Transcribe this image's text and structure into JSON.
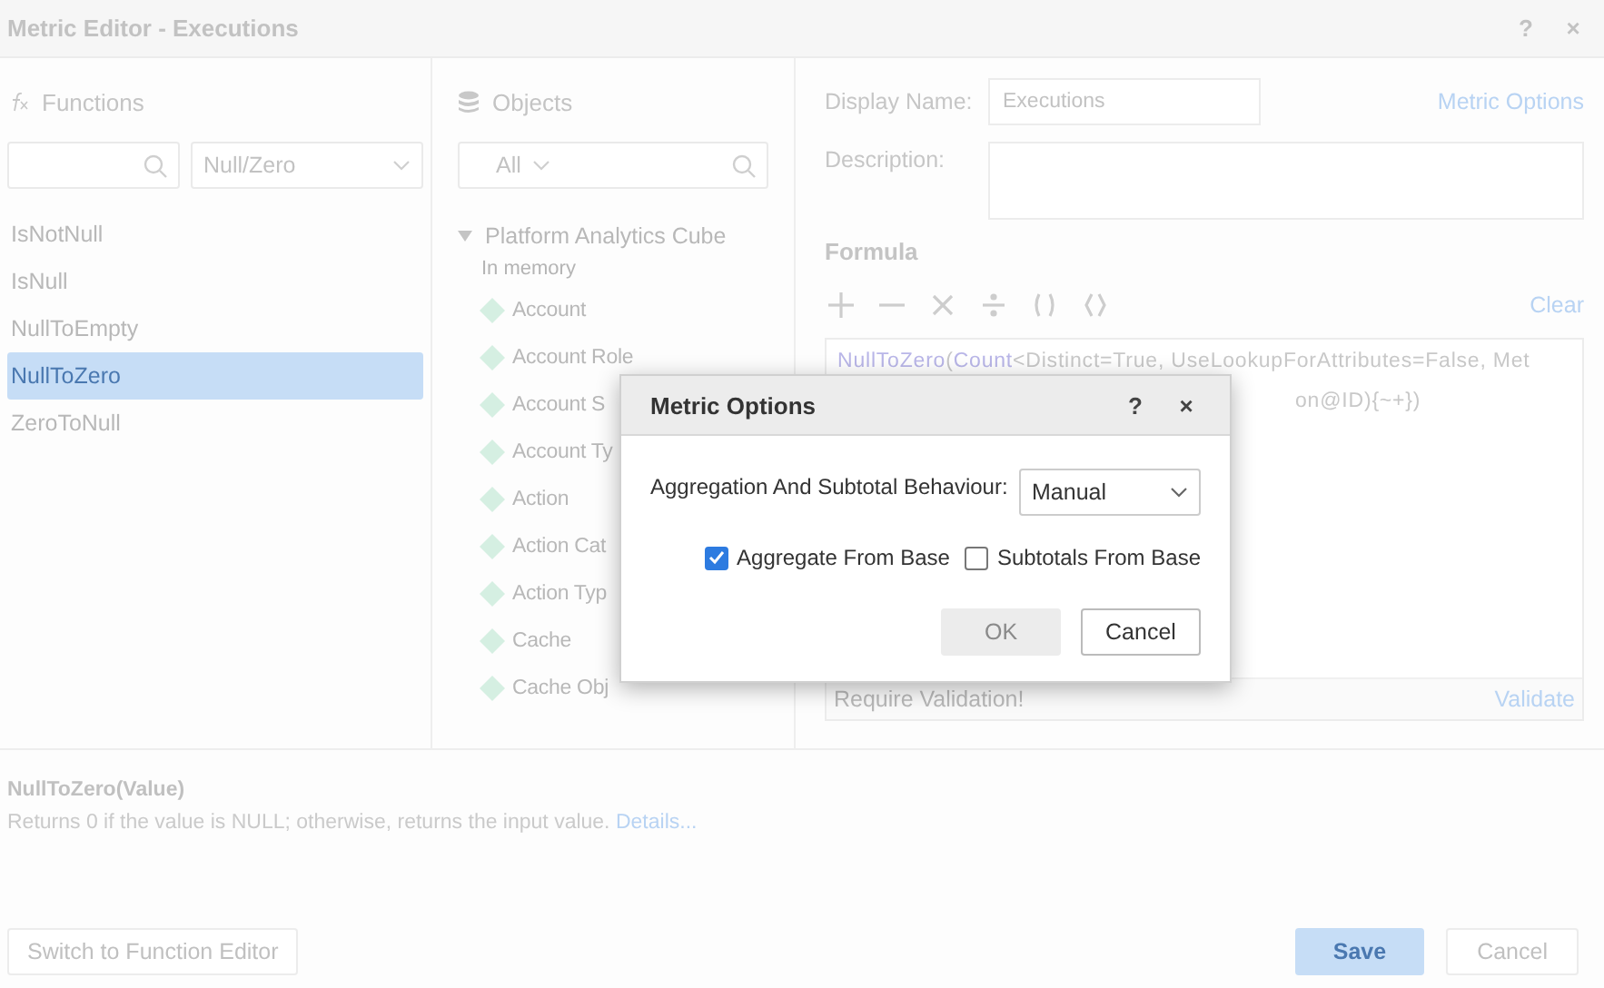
{
  "window": {
    "title": "Metric Editor - Executions",
    "help": "?",
    "close": "×"
  },
  "functions": {
    "title": "Functions",
    "category": "Null/Zero",
    "items": [
      {
        "label": "IsNotNull",
        "selected": false
      },
      {
        "label": "IsNull",
        "selected": false
      },
      {
        "label": "NullToEmpty",
        "selected": false
      },
      {
        "label": "NullToZero",
        "selected": true
      },
      {
        "label": "ZeroToNull",
        "selected": false
      }
    ]
  },
  "objects": {
    "title": "Objects",
    "filter": "All",
    "tree": {
      "label": "Platform Analytics Cube",
      "expanded": true,
      "note": "In memory",
      "children": [
        {
          "label": "Account"
        },
        {
          "label": "Account Role"
        },
        {
          "label": "Account S"
        },
        {
          "label": "Account Ty"
        },
        {
          "label": "Action"
        },
        {
          "label": "Action Cat"
        },
        {
          "label": "Action Typ"
        },
        {
          "label": "Cache"
        },
        {
          "label": "Cache Obj"
        }
      ]
    }
  },
  "metric": {
    "display_name_label": "Display Name:",
    "display_name": "Executions",
    "options_link": "Metric Options",
    "description_label": "Description:",
    "formula_title": "Formula",
    "clear": "Clear",
    "formula_lines": [
      [
        {
          "kind": "function",
          "text": "NullToZero"
        },
        {
          "kind": "plain",
          "text": "("
        },
        {
          "kind": "function",
          "text": "Count"
        },
        {
          "kind": "plain",
          "text": "<Distinct=True, UseLookupForAttributes=False, Met"
        }
      ],
      [
        {
          "kind": "plain",
          "text": "on@ID){~+})"
        }
      ]
    ],
    "validation_status": "Require Validation!",
    "validate": "Validate"
  },
  "help": {
    "signature": "NullToZero(Value)",
    "description": "Returns 0 if the value is NULL; otherwise, returns the input value.",
    "details_link": "Details..."
  },
  "footer": {
    "switch_button": "Switch to Function Editor",
    "save": "Save",
    "cancel": "Cancel"
  },
  "dialog": {
    "title": "Metric Options",
    "help": "?",
    "close": "×",
    "behaviour_label": "Aggregation And Subtotal Behaviour:",
    "behaviour": "Manual",
    "checkboxes": [
      {
        "label": "Aggregate From Base",
        "checked": true
      },
      {
        "label": "Subtotals From Base",
        "checked": false
      }
    ],
    "ok": {
      "label": "OK",
      "disabled": true
    },
    "cancel": "Cancel"
  }
}
